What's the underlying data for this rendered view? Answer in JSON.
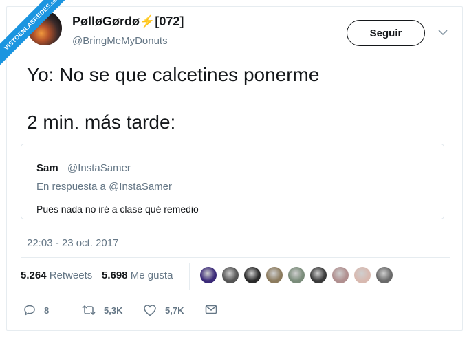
{
  "watermark": {
    "line1": "VISTOENLASREDES",
    "line2": ".com"
  },
  "tweet": {
    "author_name": "PølløGørdø⚡[072]",
    "author_handle": "@BringMeMyDonuts",
    "follow_label": "Seguir",
    "text_line1": "Yo: No se que calcetines ponerme",
    "text_line2": "2 min. más tarde:",
    "timestamp": "22:03 - 23 oct. 2017"
  },
  "quoted": {
    "author_name": "Sam",
    "author_handle": "@InstaSamer",
    "reply_to": "En respuesta a @InstaSamer",
    "text": "Pues nada no iré a clase qué remedio"
  },
  "stats": {
    "retweets_count": "5.264",
    "retweets_label": "Retweets",
    "likes_count": "5.698",
    "likes_label": "Me gusta"
  },
  "likers": [
    {
      "icon": "avatar",
      "color": "#3b2a78"
    },
    {
      "icon": "avatar",
      "color": "#555555"
    },
    {
      "icon": "avatar",
      "color": "#2a2a2a"
    },
    {
      "icon": "avatar",
      "color": "#8c7b5e"
    },
    {
      "icon": "avatar",
      "color": "#7a8c7a"
    },
    {
      "icon": "avatar",
      "color": "#3a3a3a"
    },
    {
      "icon": "avatar",
      "color": "#b08f8f"
    },
    {
      "icon": "avatar",
      "color": "#d8b9b0"
    },
    {
      "icon": "avatar",
      "color": "#6a6a6a"
    }
  ],
  "actions": {
    "replies": "8",
    "retweets": "5,3K",
    "likes": "5,7K"
  }
}
